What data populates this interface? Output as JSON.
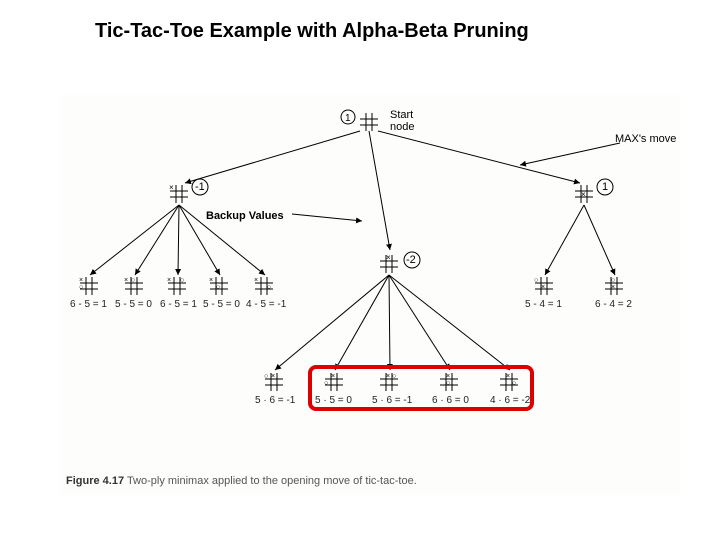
{
  "title": "Tic-Tac-Toe Example with Alpha-Beta Pruning",
  "backup_label": "Backup Values",
  "start_node": "Start\nnode",
  "max_move": "MAX's move",
  "vals": {
    "root": "1",
    "left": "-1",
    "mid": "-2",
    "right": "1"
  },
  "row1": {
    "e1": "6 - 5 = 1",
    "e2": "5 - 5 = 0",
    "e3": "6 - 5 = 1",
    "e4": "5 - 5 = 0",
    "e5": "4 - 5 = -1"
  },
  "row_right": {
    "e1": "5 - 4 = 1",
    "e2": "6 - 4 = 2"
  },
  "row_bottom": {
    "e1": "5 · 6 = -1",
    "e2": "5 · 5 = 0",
    "e3": "5 · 6 = -1",
    "e4": "6 · 6 = 0",
    "e5": "4 · 6 = -2"
  },
  "caption_bold": "Figure 4.17",
  "caption_text": "Two-ply minimax applied to the opening move of tic-tac-toe."
}
